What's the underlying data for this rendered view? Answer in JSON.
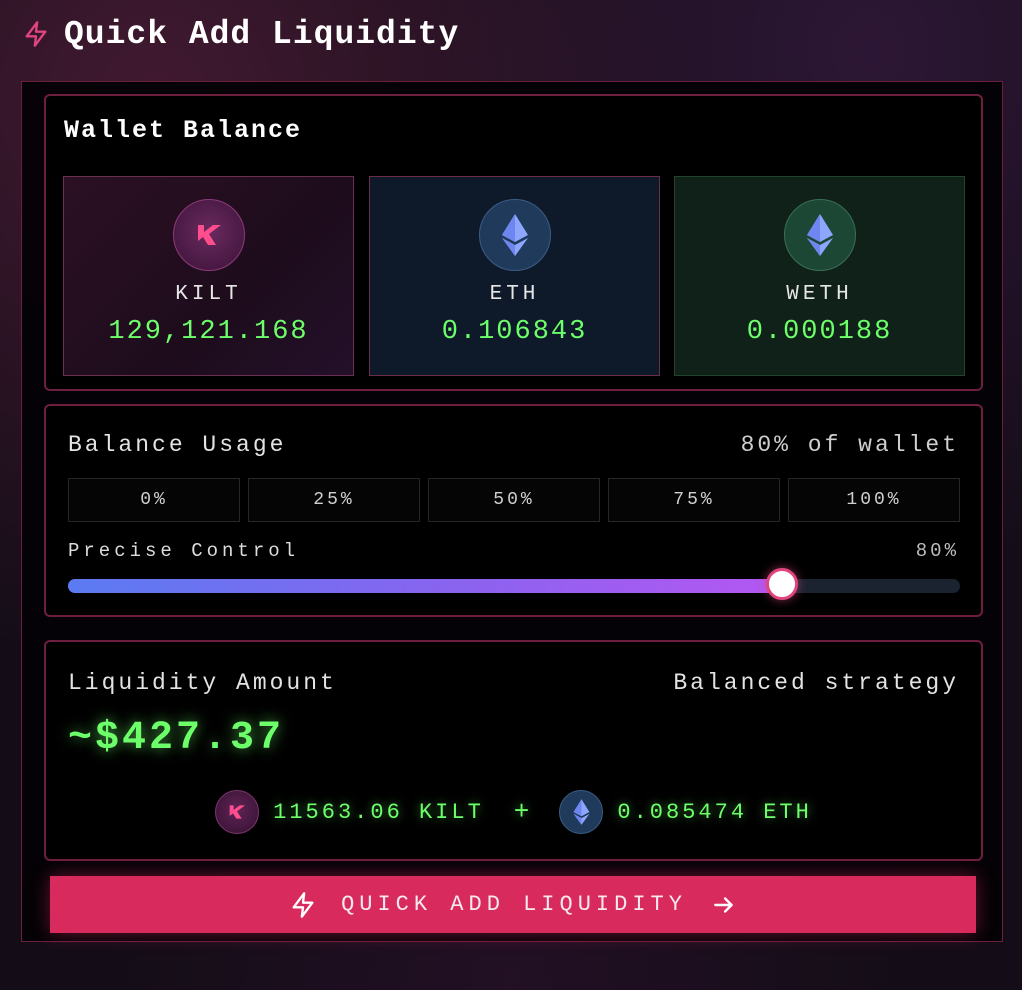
{
  "header": {
    "title": "Quick Add Liquidity",
    "icon": "lightning-bolt-icon"
  },
  "wallet": {
    "title": "Wallet Balance",
    "tokens": [
      {
        "symbol": "KILT",
        "balance": "129,121.168",
        "icon": "kilt-logo-icon"
      },
      {
        "symbol": "ETH",
        "balance": "0.106843",
        "icon": "ethereum-icon"
      },
      {
        "symbol": "WETH",
        "balance": "0.000188",
        "icon": "ethereum-icon"
      }
    ]
  },
  "usage": {
    "label": "Balance Usage",
    "value_text": "80% of wallet",
    "presets": [
      "0%",
      "25%",
      "50%",
      "75%",
      "100%"
    ],
    "precise_label": "Precise Control",
    "precise_value": "80%",
    "slider_fraction": 0.8
  },
  "liquidity": {
    "label": "Liquidity Amount",
    "strategy": "Balanced strategy",
    "amount": "~$427.37",
    "kilt_amount": "11563.06 KILT",
    "plus": "+",
    "eth_amount": "0.085474 ETH"
  },
  "cta": {
    "label": "QUICK ADD LIQUIDITY"
  },
  "colors": {
    "accent": "#d92a5e",
    "value_green": "#6dff6a",
    "panel_border": "#6e1f3e"
  }
}
